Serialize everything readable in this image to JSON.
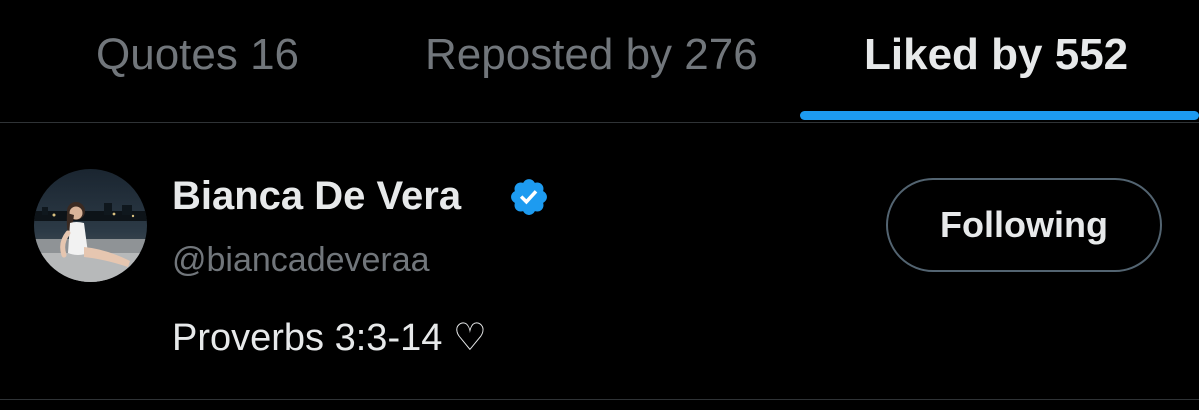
{
  "tabs": [
    {
      "label": "Quotes 16",
      "active": false
    },
    {
      "label": "Reposted by 276",
      "active": false
    },
    {
      "label": "Liked by 552",
      "active": true
    }
  ],
  "user": {
    "display_name": "Bianca De Vera",
    "verified": true,
    "handle": "@biancadeveraa",
    "bio": "Proverbs 3:3-14 ♡",
    "follow_button_label": "Following"
  },
  "colors": {
    "background": "#000000",
    "accent": "#1d9bf0",
    "primary_text": "#e7e9ea",
    "secondary_text": "#71767b",
    "divider": "#2f3336"
  },
  "icons": {
    "verified": "verified-badge-icon",
    "avatar": "profile-photo"
  }
}
